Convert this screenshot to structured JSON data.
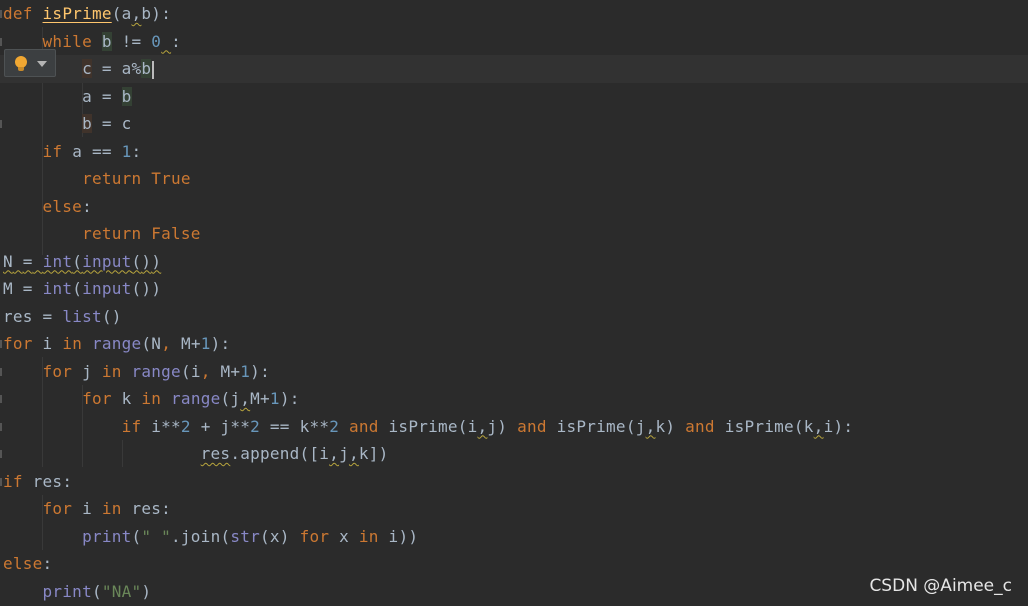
{
  "colors": {
    "background": "#2b2b2b",
    "keyword": "#cc7832",
    "function": "#ffc66d",
    "builtin": "#8888c6",
    "number": "#6897bb",
    "string": "#6a8759",
    "text": "#a9b7c6"
  },
  "intention_popup": {
    "icon": "lightbulb-icon",
    "arrow": "chevron-down-icon"
  },
  "code": {
    "def": "def",
    "isPrime": "isPrime",
    "a": "a",
    "b": "b",
    "c": "c",
    "while": "while",
    "neq": "!=",
    "zero": "0",
    "eq": "=",
    "mod": "%",
    "if": "if",
    "eqeq": "==",
    "one": "1",
    "two": "2",
    "return": "return",
    "True": "True",
    "False": "False",
    "else": "else",
    "colon": ":",
    "comma": ",",
    "lp": "(",
    "rp": ")",
    "lb": "[",
    "rb": "]",
    "N": "N",
    "M": "M",
    "int": "int",
    "input": "input",
    "res": "res",
    "list": "list",
    "for": "for",
    "in": "in",
    "range": "range",
    "i": "i",
    "j": "j",
    "k": "k",
    "plus": "+",
    "pow": "**",
    "and": "and",
    "dot_append": ".append",
    "print": "print",
    "space_str": "\" \"",
    "dot_join": ".join",
    "str": "str",
    "x": "x",
    "na_str": "\"NA\""
  },
  "watermark": "CSDN @Aimee_c"
}
